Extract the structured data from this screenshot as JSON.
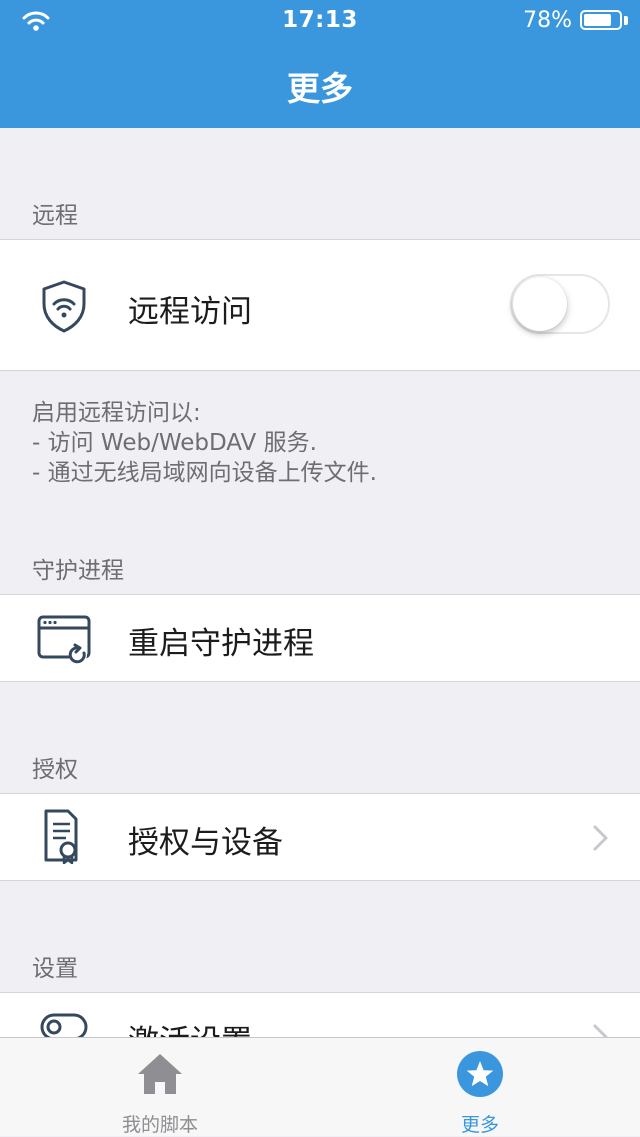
{
  "status_bar": {
    "time": "17:13",
    "battery": "78%"
  },
  "nav": {
    "title": "更多"
  },
  "sections": {
    "remote": {
      "header": "远程",
      "item_label": "远程访问",
      "toggle_on": false,
      "footnote_lines": [
        "启用远程访问以:",
        "- 访问 Web/WebDAV 服务.",
        "- 通过无线局域网向设备上传文件."
      ]
    },
    "daemon": {
      "header": "守护进程",
      "item_label": "重启守护进程"
    },
    "license": {
      "header": "授权",
      "item_label": "授权与设备"
    },
    "settings": {
      "header": "设置",
      "item_label": "激活设置"
    }
  },
  "tabbar": {
    "tabs": [
      {
        "label": "我的脚本",
        "icon": "home-icon",
        "active": false
      },
      {
        "label": "更多",
        "icon": "star-icon",
        "active": true
      }
    ]
  },
  "colors": {
    "accent": "#3a97dd",
    "tab_inactive": "#8e8e93",
    "icon_stroke": "#34495e"
  }
}
